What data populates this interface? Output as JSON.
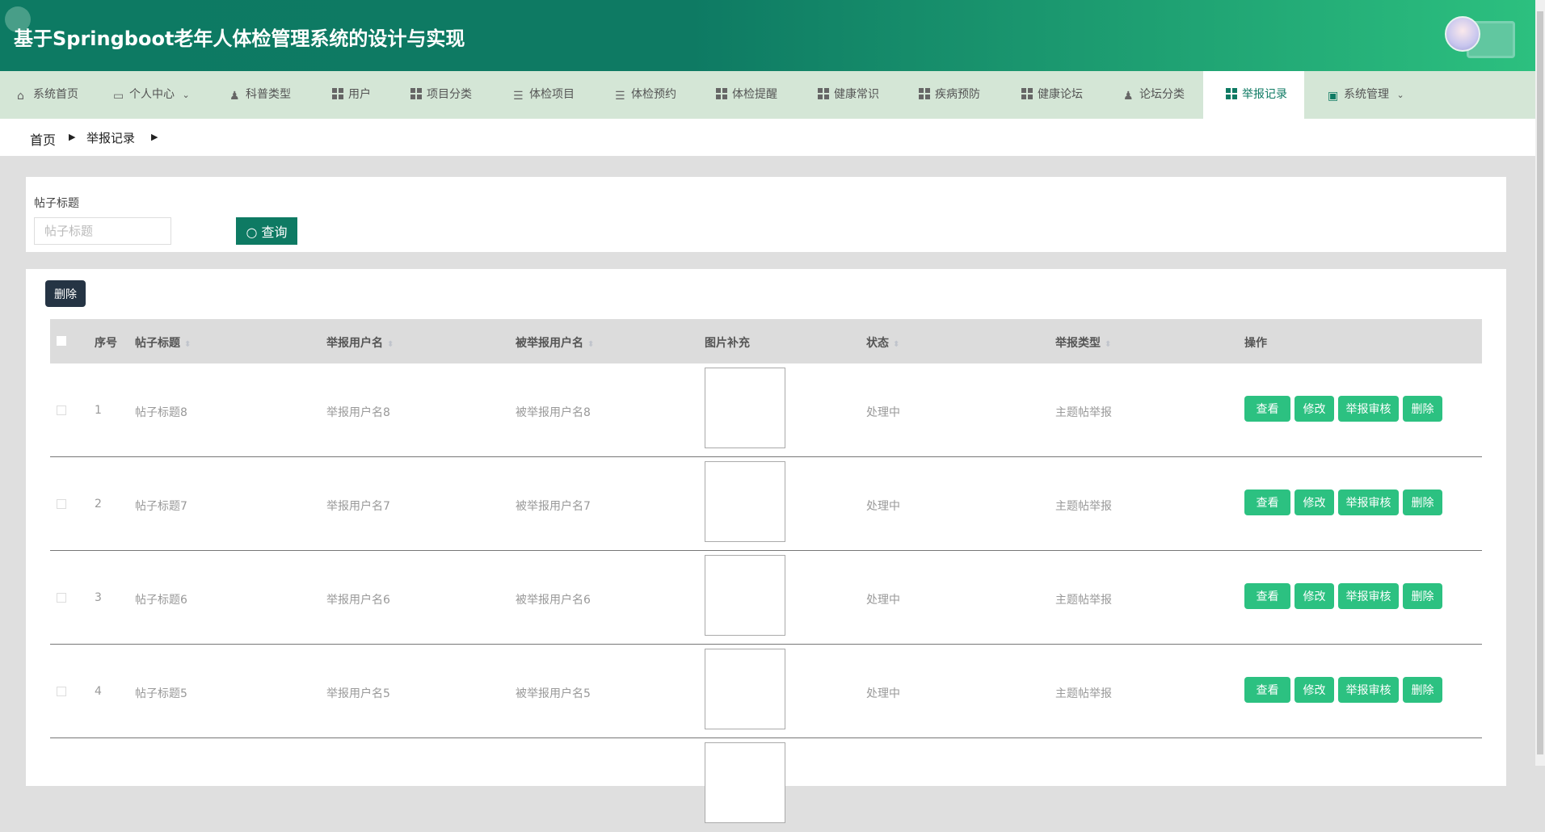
{
  "header": {
    "title": "基于Springboot老年人体检管理系统的设计与实现"
  },
  "nav": [
    {
      "label": "系统首页",
      "icon": "home-icon"
    },
    {
      "label": "个人中心",
      "icon": "card-icon",
      "dropdown": true
    },
    {
      "label": "科普类型",
      "icon": "user-icon"
    },
    {
      "label": "用户",
      "icon": "grid-icon"
    },
    {
      "label": "项目分类",
      "icon": "grid-icon"
    },
    {
      "label": "体检项目",
      "icon": "list-icon"
    },
    {
      "label": "体检预约",
      "icon": "list-icon"
    },
    {
      "label": "体检提醒",
      "icon": "grid9-icon"
    },
    {
      "label": "健康常识",
      "icon": "grid-icon"
    },
    {
      "label": "疾病预防",
      "icon": "grid-icon"
    },
    {
      "label": "健康论坛",
      "icon": "grid-icon"
    },
    {
      "label": "论坛分类",
      "icon": "user-icon"
    },
    {
      "label": "举报记录",
      "icon": "grid-icon",
      "active": true
    },
    {
      "label": "系统管理",
      "icon": "check-icon",
      "dropdown": true
    }
  ],
  "breadcrumb": [
    "首页",
    "举报记录"
  ],
  "search": {
    "label": "帖子标题",
    "placeholder": "帖子标题",
    "value": "",
    "button": "查询"
  },
  "toolbar": {
    "delete": "删除"
  },
  "table": {
    "headers": [
      "序号",
      "帖子标题",
      "举报用户名",
      "被举报用户名",
      "图片补充",
      "状态",
      "举报类型",
      "操作"
    ],
    "rows": [
      {
        "no": "1",
        "title": "帖子标题8",
        "reporter": "举报用户名8",
        "reported": "被举报用户名8",
        "status": "处理中",
        "type": "主题帖举报"
      },
      {
        "no": "2",
        "title": "帖子标题7",
        "reporter": "举报用户名7",
        "reported": "被举报用户名7",
        "status": "处理中",
        "type": "主题帖举报"
      },
      {
        "no": "3",
        "title": "帖子标题6",
        "reporter": "举报用户名6",
        "reported": "被举报用户名6",
        "status": "处理中",
        "type": "主题帖举报"
      },
      {
        "no": "4",
        "title": "帖子标题5",
        "reporter": "举报用户名5",
        "reported": "被举报用户名5",
        "status": "处理中",
        "type": "主题帖举报"
      }
    ],
    "actions": [
      "查看",
      "修改",
      "举报审核",
      "删除"
    ]
  },
  "colors": {
    "primary": "#0e7a63",
    "action": "#2cc181",
    "nav_bg": "#d4e6d6"
  }
}
